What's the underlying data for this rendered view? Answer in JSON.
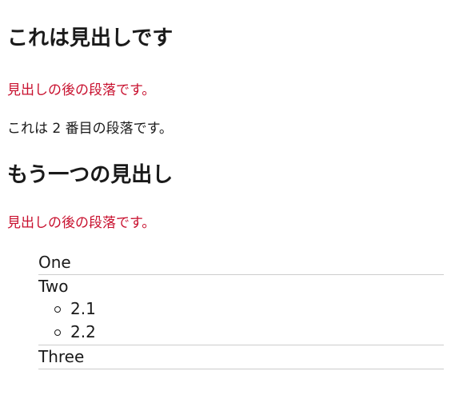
{
  "heading1": "これは見出しです",
  "para1": "見出しの後の段落です。",
  "para2": "これは 2 番目の段落です。",
  "heading2": "もう一つの見出し",
  "para3": "見出しの後の段落です。",
  "list": {
    "items": [
      {
        "label": "One"
      },
      {
        "label": "Two",
        "subitems": [
          "2.1",
          "2.2"
        ]
      },
      {
        "label": "Three"
      }
    ]
  },
  "colors": {
    "accent_red": "#c8102e",
    "text": "#1a1a1a",
    "divider": "#cccccc"
  }
}
